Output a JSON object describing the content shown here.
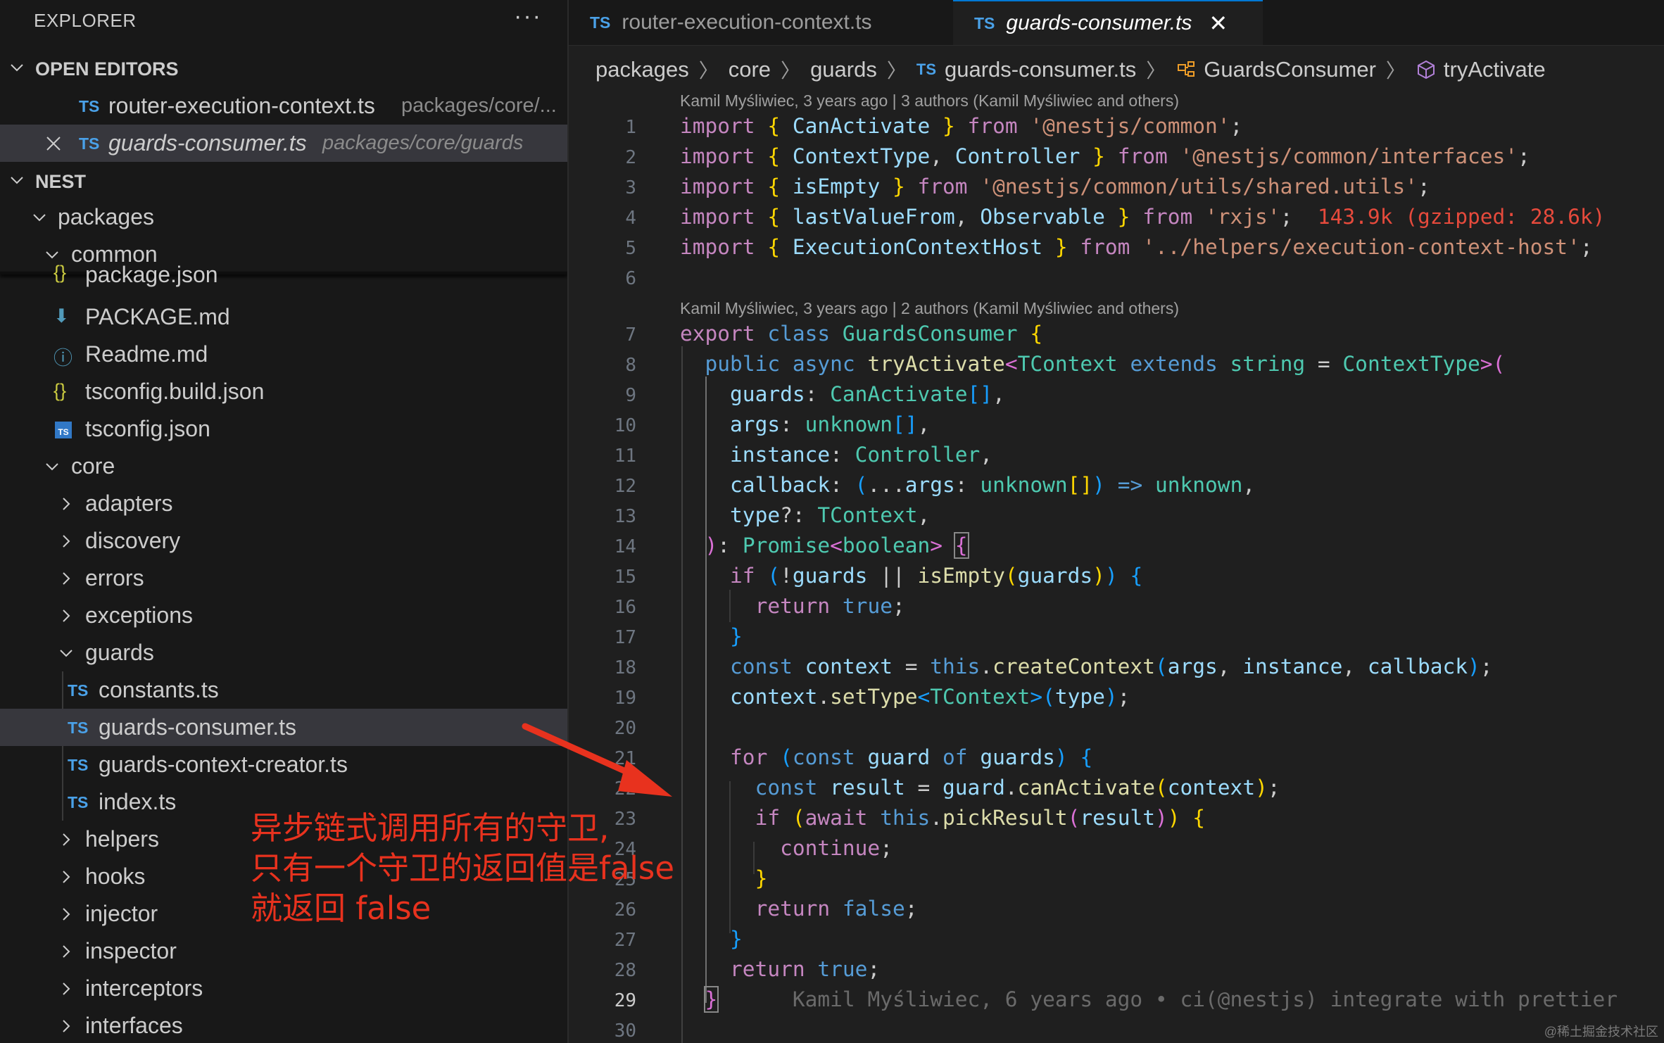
{
  "sidebar": {
    "title": "EXPLORER",
    "more_glyph": "···",
    "open_editors": {
      "header": "OPEN EDITORS",
      "items": [
        {
          "type": "TS",
          "name": "router-execution-context.ts",
          "path": "packages/core/..."
        },
        {
          "type": "TS",
          "name": "guards-consumer.ts",
          "path": "packages/core/guards",
          "active": true
        }
      ]
    },
    "workspace": {
      "header": "NEST",
      "tree": [
        {
          "label": "packages",
          "kind": "folder-open"
        },
        {
          "label": "common",
          "kind": "folder-open"
        },
        {
          "label": "package.json",
          "kind": "json"
        },
        {
          "label": "PACKAGE.md",
          "kind": "md-download"
        },
        {
          "label": "Readme.md",
          "kind": "md-info"
        },
        {
          "label": "tsconfig.build.json",
          "kind": "json"
        },
        {
          "label": "tsconfig.json",
          "kind": "tsconfig"
        },
        {
          "label": "core",
          "kind": "folder-open"
        },
        {
          "label": "adapters",
          "kind": "folder"
        },
        {
          "label": "discovery",
          "kind": "folder"
        },
        {
          "label": "errors",
          "kind": "folder"
        },
        {
          "label": "exceptions",
          "kind": "folder"
        },
        {
          "label": "guards",
          "kind": "folder-open"
        },
        {
          "label": "constants.ts",
          "kind": "ts"
        },
        {
          "label": "guards-consumer.ts",
          "kind": "ts",
          "active": true
        },
        {
          "label": "guards-context-creator.ts",
          "kind": "ts"
        },
        {
          "label": "index.ts",
          "kind": "ts"
        },
        {
          "label": "helpers",
          "kind": "folder"
        },
        {
          "label": "hooks",
          "kind": "folder"
        },
        {
          "label": "injector",
          "kind": "folder"
        },
        {
          "label": "inspector",
          "kind": "folder"
        },
        {
          "label": "interceptors",
          "kind": "folder"
        },
        {
          "label": "interfaces",
          "kind": "folder"
        }
      ]
    }
  },
  "tabs": [
    {
      "type": "TS",
      "name": "router-execution-context.ts",
      "active": false
    },
    {
      "type": "TS",
      "name": "guards-consumer.ts",
      "active": true
    }
  ],
  "breadcrumb": [
    "packages",
    "core",
    "guards",
    "guards-consumer.ts",
    "GuardsConsumer",
    "tryActivate"
  ],
  "blame": {
    "imports": "Kamil Myśliwiec, 3 years ago | 3 authors (Kamil Myśliwiec and others)",
    "class": "Kamil Myśliwiec, 3 years ago | 2 authors (Kamil Myśliwiec and others)",
    "inline_line29": "Kamil Myśliwiec, 6 years ago • ci(@nestjs) integrate with prettier"
  },
  "import_cost": "143.9k (gzipped: 28.6k)",
  "line_numbers": [
    "1",
    "2",
    "3",
    "4",
    "5",
    "6",
    "7",
    "8",
    "9",
    "10",
    "11",
    "12",
    "13",
    "14",
    "15",
    "16",
    "17",
    "18",
    "19",
    "20",
    "21",
    "22",
    "23",
    "24",
    "25",
    "26",
    "27",
    "28",
    "29",
    "30"
  ],
  "current_line": "29",
  "code_lines": [
    "import { CanActivate } from '@nestjs/common';",
    "import { ContextType, Controller } from '@nestjs/common/interfaces';",
    "import { isEmpty } from '@nestjs/common/utils/shared.utils';",
    "import { lastValueFrom, Observable } from 'rxjs';",
    "import { ExecutionContextHost } from '../helpers/execution-context-host';",
    "",
    "export class GuardsConsumer {",
    "  public async tryActivate<TContext extends string = ContextType>(",
    "    guards: CanActivate[],",
    "    args: unknown[],",
    "    instance: Controller,",
    "    callback: (...args: unknown[]) => unknown,",
    "    type?: TContext,",
    "  ): Promise<boolean> {",
    "    if (!guards || isEmpty(guards)) {",
    "      return true;",
    "    }",
    "    const context = this.createContext(args, instance, callback);",
    "    context.setType<TContext>(type);",
    "",
    "    for (const guard of guards) {",
    "      const result = guard.canActivate(context);",
    "      if (await this.pickResult(result)) {",
    "        continue;",
    "      }",
    "      return false;",
    "    }",
    "    return true;",
    "  }",
    ""
  ],
  "annotation": {
    "text": "异步链式调用所有的守卫,\n只有一个守卫的返回值是false\n就返回 false",
    "color": "#e8321e"
  },
  "watermark": "@稀土掘金技术社区",
  "colors": {
    "accent": "#0078d4",
    "ts_icon": "#4aa1e8",
    "annotation_red": "#e8321e"
  }
}
